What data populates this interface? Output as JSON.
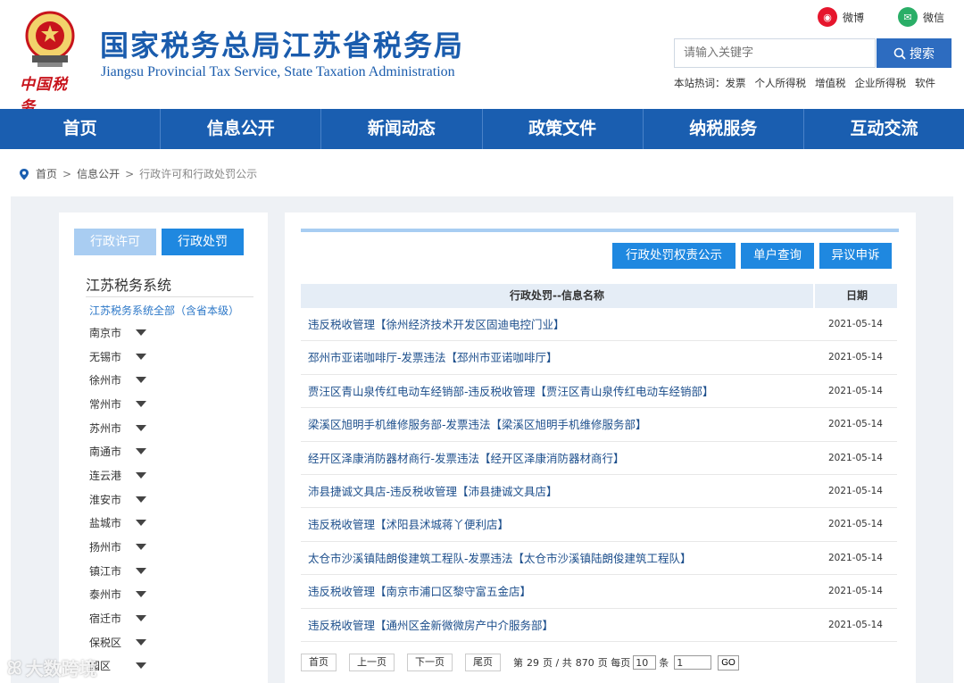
{
  "header": {
    "brand_cn": "中国税务",
    "title": "国家税务总局江苏省税务局",
    "subtitle": "Jiangsu Provincial Tax Service, State Taxation Administration",
    "weibo_label": "微博",
    "wechat_label": "微信",
    "search_placeholder": "请输入关键字",
    "search_button": "搜索",
    "hot_label": "本站热词：",
    "hot_words": [
      "发票",
      "个人所得税",
      "增值税",
      "企业所得税",
      "软件"
    ]
  },
  "nav": [
    "首页",
    "信息公开",
    "新闻动态",
    "政策文件",
    "纳税服务",
    "互动交流"
  ],
  "breadcrumb": [
    "首页",
    "信息公开",
    "行政许可和行政处罚公示"
  ],
  "sidebar": {
    "tabs": [
      "行政许可",
      "行政处罚"
    ],
    "title": "江苏税务系统",
    "all_link": "江苏税务系统全部（含省本级）",
    "cities": [
      "南京市",
      "无锡市",
      "徐州市",
      "常州市",
      "苏州市",
      "南通市",
      "连云港",
      "淮安市",
      "盐城市",
      "扬州市",
      "镇江市",
      "泰州市",
      "宿迁市",
      "保税区",
      "园区"
    ]
  },
  "main": {
    "buttons": [
      "行政处罚权责公示",
      "单户查询",
      "异议申诉"
    ],
    "col_name": "行政处罚--信息名称",
    "col_date": "日期",
    "rows": [
      {
        "title": "违反税收管理【徐州经济技术开发区固迪电控门业】",
        "date": "2021-05-14"
      },
      {
        "title": "邳州市亚诺咖啡厅-发票违法【邳州市亚诺咖啡厅】",
        "date": "2021-05-14"
      },
      {
        "title": "贾汪区青山泉传红电动车经销部-违反税收管理【贾汪区青山泉传红电动车经销部】",
        "date": "2021-05-14"
      },
      {
        "title": "梁溪区旭明手机维修服务部-发票违法【梁溪区旭明手机维修服务部】",
        "date": "2021-05-14"
      },
      {
        "title": "经开区泽康消防器材商行-发票违法【经开区泽康消防器材商行】",
        "date": "2021-05-14"
      },
      {
        "title": "沛县捷诚文具店-违反税收管理【沛县捷诚文具店】",
        "date": "2021-05-14"
      },
      {
        "title": "违反税收管理【沭阳县沭城蒋丫便利店】",
        "date": "2021-05-14"
      },
      {
        "title": "太仓市沙溪镇陆朗俊建筑工程队-发票违法【太仓市沙溪镇陆朗俊建筑工程队】",
        "date": "2021-05-14"
      },
      {
        "title": "违反税收管理【南京市浦口区黎守富五金店】",
        "date": "2021-05-14"
      },
      {
        "title": "违反税收管理【通州区金新微微房产中介服务部】",
        "date": "2021-05-14"
      }
    ]
  },
  "pager": {
    "first": "首页",
    "prev": "上一页",
    "next": "下一页",
    "last": "尾页",
    "text_di": "第",
    "current_page": "29",
    "text_page_total": "页 / 共",
    "total_pages": "870",
    "text_page_per": "页 每页",
    "per_page": "10",
    "text_items": "条",
    "jump_value": "1",
    "go": "GO"
  },
  "watermark": "大数跨境",
  "colors": {
    "nav_bg": "#1a5eb0",
    "title_blue": "#1a5cad",
    "button_blue": "#1f88e0",
    "inactive_tab": "#a9cdf2"
  }
}
